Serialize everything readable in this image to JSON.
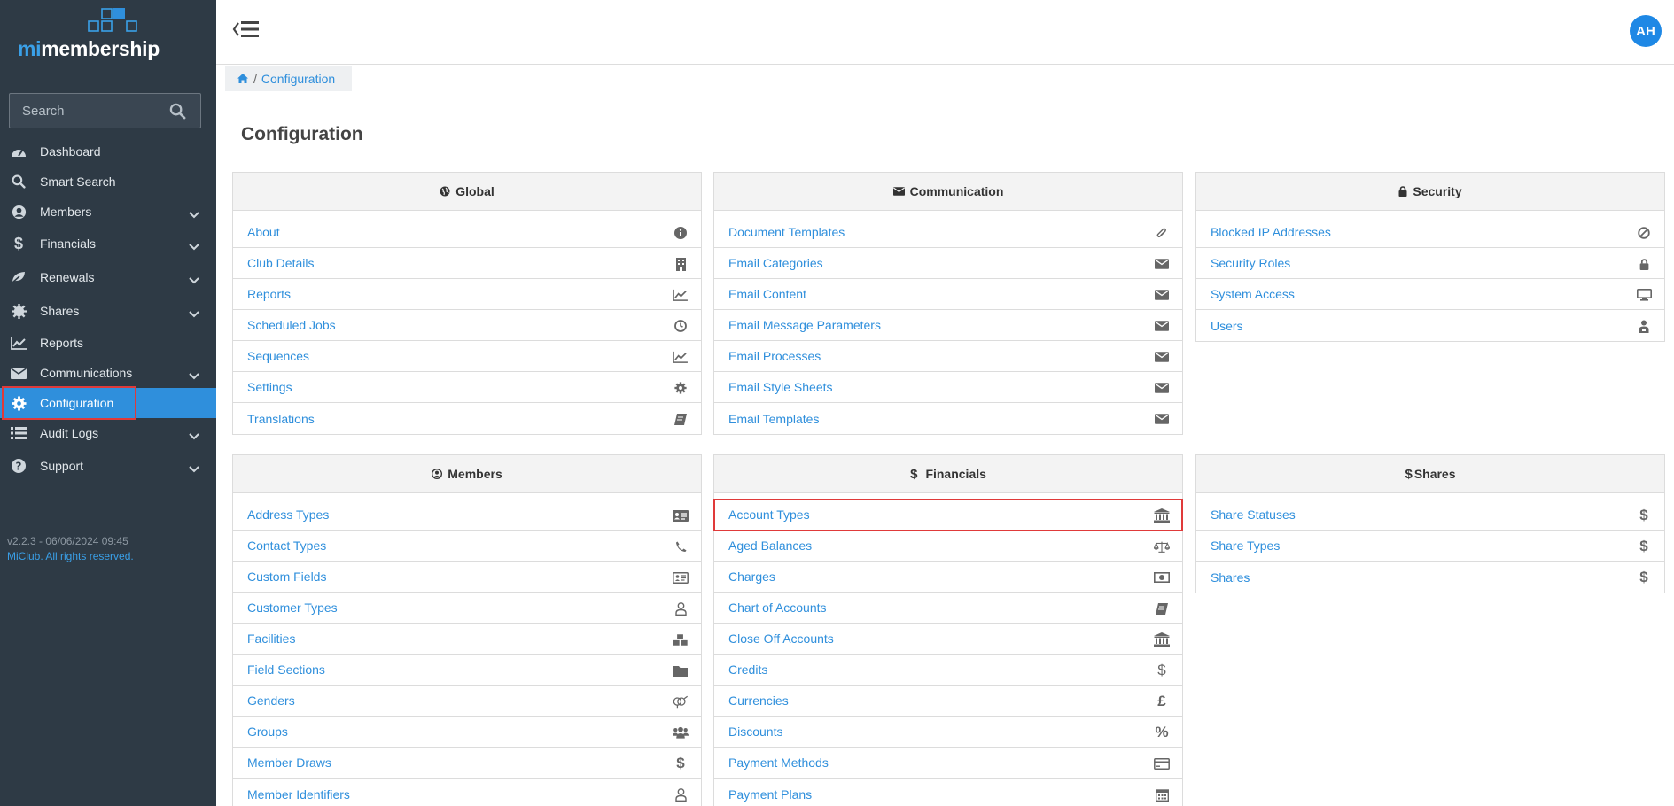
{
  "app": {
    "logo_prefix": "mi",
    "logo_name": "membership"
  },
  "search": {
    "placeholder": "Search"
  },
  "nav": [
    {
      "label": "Dashboard",
      "icon": "dashboard-icon",
      "chevron": false
    },
    {
      "label": "Smart Search",
      "icon": "search-icon",
      "chevron": false
    },
    {
      "label": "Members",
      "icon": "user-circle-icon",
      "chevron": true
    },
    {
      "label": "Financials",
      "icon": "dollar-icon",
      "chevron": true
    },
    {
      "label": "Renewals",
      "icon": "leaf-icon",
      "chevron": true
    },
    {
      "label": "Shares",
      "icon": "gear-burst-icon",
      "chevron": true
    },
    {
      "label": "Reports",
      "icon": "line-chart-icon",
      "chevron": false
    },
    {
      "label": "Communications",
      "icon": "envelope-icon",
      "chevron": true
    },
    {
      "label": "Configuration",
      "icon": "gear-icon",
      "chevron": false,
      "active": true
    },
    {
      "label": "Audit Logs",
      "icon": "list-icon",
      "chevron": true
    },
    {
      "label": "Support",
      "icon": "question-icon",
      "chevron": true
    }
  ],
  "footer": {
    "version": "v2.2.3 - 06/06/2024 09:45",
    "rights": "MiClub. All rights reserved."
  },
  "header": {
    "avatar": "AH"
  },
  "breadcrumb": {
    "current": "Configuration"
  },
  "page_title": "Configuration",
  "panels": {
    "global": {
      "title": "Global",
      "items": [
        {
          "label": "About",
          "icon": "info-icon"
        },
        {
          "label": "Club Details",
          "icon": "building-icon"
        },
        {
          "label": "Reports",
          "icon": "line-chart-icon"
        },
        {
          "label": "Scheduled Jobs",
          "icon": "clock-icon"
        },
        {
          "label": "Sequences",
          "icon": "line-chart-icon"
        },
        {
          "label": "Settings",
          "icon": "gear-icon"
        },
        {
          "label": "Translations",
          "icon": "book-icon"
        }
      ]
    },
    "communication": {
      "title": "Communication",
      "items": [
        {
          "label": "Document Templates",
          "icon": "paperclip-icon"
        },
        {
          "label": "Email Categories",
          "icon": "envelope-icon"
        },
        {
          "label": "Email Content",
          "icon": "envelope-icon"
        },
        {
          "label": "Email Message Parameters",
          "icon": "envelope-icon"
        },
        {
          "label": "Email Processes",
          "icon": "envelope-icon"
        },
        {
          "label": "Email Style Sheets",
          "icon": "envelope-icon"
        },
        {
          "label": "Email Templates",
          "icon": "envelope-icon"
        }
      ]
    },
    "security": {
      "title": "Security",
      "items": [
        {
          "label": "Blocked IP Addresses",
          "icon": "ban-icon"
        },
        {
          "label": "Security Roles",
          "icon": "lock-icon"
        },
        {
          "label": "System Access",
          "icon": "desktop-icon"
        },
        {
          "label": "Users",
          "icon": "user-lock-icon"
        }
      ]
    },
    "members": {
      "title": "Members",
      "items": [
        {
          "label": "Address Types",
          "icon": "address-card-icon"
        },
        {
          "label": "Contact Types",
          "icon": "phone-icon"
        },
        {
          "label": "Custom Fields",
          "icon": "id-card-icon"
        },
        {
          "label": "Customer Types",
          "icon": "user-outline-icon"
        },
        {
          "label": "Facilities",
          "icon": "cubes-icon"
        },
        {
          "label": "Field Sections",
          "icon": "folder-icon"
        },
        {
          "label": "Genders",
          "icon": "genderless-icon"
        },
        {
          "label": "Groups",
          "icon": "users-icon"
        },
        {
          "label": "Member Draws",
          "icon": "dollar-icon"
        },
        {
          "label": "Member Identifiers",
          "icon": "user-outline-icon"
        }
      ]
    },
    "financials": {
      "title": "Financials",
      "items": [
        {
          "label": "Account Types",
          "icon": "bank-icon",
          "highlight": true
        },
        {
          "label": "Aged Balances",
          "icon": "scale-icon"
        },
        {
          "label": "Charges",
          "icon": "money-icon"
        },
        {
          "label": "Chart of Accounts",
          "icon": "book-icon"
        },
        {
          "label": "Close Off Accounts",
          "icon": "bank-icon"
        },
        {
          "label": "Credits",
          "icon": "dollar-icon"
        },
        {
          "label": "Currencies",
          "icon": "pound-icon"
        },
        {
          "label": "Discounts",
          "icon": "percent-icon"
        },
        {
          "label": "Payment Methods",
          "icon": "credit-card-icon"
        },
        {
          "label": "Payment Plans",
          "icon": "calendar-icon"
        }
      ]
    },
    "shares": {
      "title": "Shares",
      "items": [
        {
          "label": "Share Statuses",
          "icon": "dollar-icon"
        },
        {
          "label": "Share Types",
          "icon": "dollar-icon"
        },
        {
          "label": "Shares",
          "icon": "dollar-icon"
        }
      ]
    }
  },
  "colors": {
    "sidebar_bg": "#2e3a45",
    "accent": "#2f8fdc",
    "highlight_border": "#e03a3a"
  }
}
